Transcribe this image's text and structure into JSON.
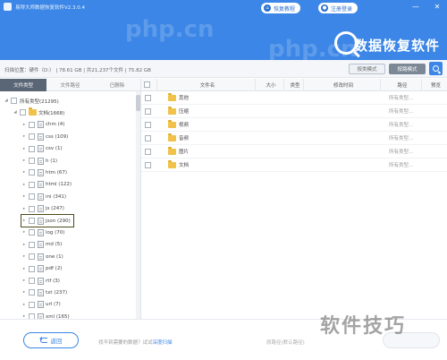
{
  "app": {
    "title": "易得大师数据恢复软件V2.3.0.4",
    "brand": "数据恢复软件",
    "deco_text": "php.cn"
  },
  "header": {
    "pill_left": "恢复教程",
    "pill_right": "注册登录",
    "min": "—",
    "close": "✕"
  },
  "infobar": {
    "summary": "扫描位置：硬件（D:）  |  78.61 GB  |  共21,237个文件  |  75.82 GB",
    "btn_mode": "按类模式",
    "btn_path": "按路模式"
  },
  "tabs": [
    "文件类型",
    "文件路径",
    "已删除"
  ],
  "tree": [
    {
      "label": "所有类型(21295)",
      "level": 0,
      "kind": "root"
    },
    {
      "label": "文档(1668)",
      "level": 1,
      "kind": "folder"
    },
    {
      "label": "chm (4)",
      "level": 2,
      "kind": "file"
    },
    {
      "label": "css (109)",
      "level": 2,
      "kind": "file"
    },
    {
      "label": "csv (1)",
      "level": 2,
      "kind": "file"
    },
    {
      "label": "h (1)",
      "level": 2,
      "kind": "file"
    },
    {
      "label": "htm (67)",
      "level": 2,
      "kind": "file"
    },
    {
      "label": "html (122)",
      "level": 2,
      "kind": "file"
    },
    {
      "label": "ini (341)",
      "level": 2,
      "kind": "file"
    },
    {
      "label": "js (247)",
      "level": 2,
      "kind": "file"
    },
    {
      "label": "json (290)",
      "level": 2,
      "kind": "file",
      "highlight": true
    },
    {
      "label": "log (70)",
      "level": 2,
      "kind": "file"
    },
    {
      "label": "md (5)",
      "level": 2,
      "kind": "file"
    },
    {
      "label": "one (1)",
      "level": 2,
      "kind": "file"
    },
    {
      "label": "pdf (2)",
      "level": 2,
      "kind": "file"
    },
    {
      "label": "rtf (3)",
      "level": 2,
      "kind": "file"
    },
    {
      "label": "txt (237)",
      "level": 2,
      "kind": "file"
    },
    {
      "label": "url (7)",
      "level": 2,
      "kind": "file"
    },
    {
      "label": "xml (165)",
      "level": 2,
      "kind": "file"
    }
  ],
  "table": {
    "headers": [
      "文件名",
      "大小",
      "类型",
      "修改时间",
      "路径",
      "预览"
    ],
    "rows": [
      {
        "name": "其他",
        "status": "所有类型..."
      },
      {
        "name": "压缩",
        "status": "所有类型..."
      },
      {
        "name": "视频",
        "status": "所有类型..."
      },
      {
        "name": "音频",
        "status": "所有类型..."
      },
      {
        "name": "图片",
        "status": "所有类型..."
      },
      {
        "name": "文档",
        "status": "所有类型..."
      }
    ]
  },
  "footer": {
    "back": "返回",
    "hint_prefix": "找不到需要的数据？试试",
    "hint_link": "深度扫描",
    "path_text": "原路径(默认路径)"
  },
  "watermark": "软件技巧",
  "colors": {
    "accent": "#3b86e6",
    "folder": "#f0c24a",
    "active_tab": "#5a6675",
    "highlight_border": "#4d4a1a"
  }
}
